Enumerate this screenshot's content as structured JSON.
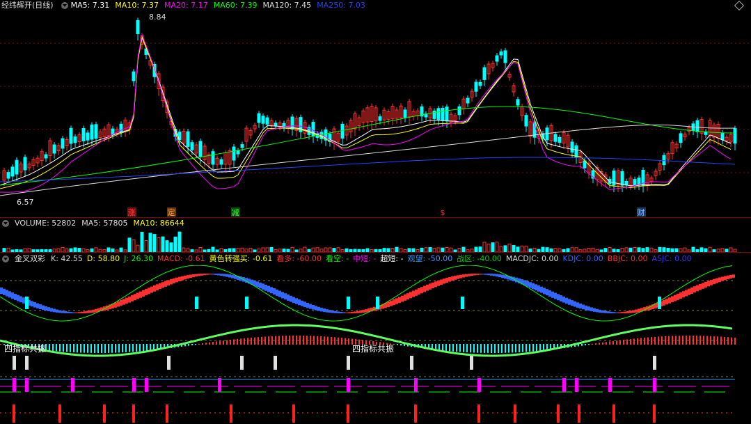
{
  "header": {
    "stock": "经纬辉开(日线)",
    "ma": [
      {
        "label": "MA5: 7.31",
        "color": "#ffffff"
      },
      {
        "label": "MA10: 7.37",
        "color": "#ffff00"
      },
      {
        "label": "MA20: 7.17",
        "color": "#ff00ff"
      },
      {
        "label": "MA60: 7.39",
        "color": "#00ff00"
      },
      {
        "label": "MA120: 7.45",
        "color": "#dddddd"
      },
      {
        "label": "MA250: 7.03",
        "color": "#2244ff"
      }
    ]
  },
  "price_chart": {
    "high_label": "8.84",
    "low_label": "6.57",
    "markers": [
      {
        "text": "涨",
        "color": "#ff4040",
        "bg": "#7a1010"
      },
      {
        "text": "定",
        "color": "#ffa040",
        "bg": "#6a3a10"
      },
      {
        "text": "减",
        "color": "#40ff40",
        "bg": "#104a10"
      },
      {
        "text": "$",
        "color": "#ff3030",
        "bg": "#000000"
      },
      {
        "text": "财",
        "color": "#80c0ff",
        "bg": "#1a3a6a"
      }
    ]
  },
  "volume": {
    "title": "VOLUME: 52802",
    "ma5": "MA5: 57805",
    "ma10": "MA10: 86644"
  },
  "indicator": {
    "title": "金叉双彩",
    "values": [
      {
        "label": "K: 42.55",
        "color": "#dddddd"
      },
      {
        "label": "D: 58.80",
        "color": "#ffff00"
      },
      {
        "label": "J: 26.30",
        "color": "#00ff00"
      },
      {
        "label": "MACD: -0.61",
        "color": "#ff3030"
      },
      {
        "label": "黄色转强买: -0.61",
        "color": "#ffff00"
      },
      {
        "label": "看多: -60.00",
        "color": "#ff3030"
      },
      {
        "label": "看空: -",
        "color": "#00ff00"
      },
      {
        "label": "中短: -",
        "color": "#ff00ff"
      },
      {
        "label": "超短: -",
        "color": "#ffffff"
      },
      {
        "label": "观望: -50.00",
        "color": "#3399ff"
      },
      {
        "label": "战区: -40.00",
        "color": "#00cc00"
      },
      {
        "label": "MACDJC: 0.00",
        "color": "#dddddd"
      },
      {
        "label": "KDJC: 0.00",
        "color": "#3366ff"
      },
      {
        "label": "BBJC: 0.00",
        "color": "#ff3030"
      },
      {
        "label": "ASJC: 0.00",
        "color": "#3333ff"
      }
    ],
    "resonance_labels": [
      "四指标共振",
      "四指标共振"
    ]
  },
  "colors": {
    "up": "#ff3030",
    "down": "#00ffff",
    "separator": "#8b0000"
  }
}
